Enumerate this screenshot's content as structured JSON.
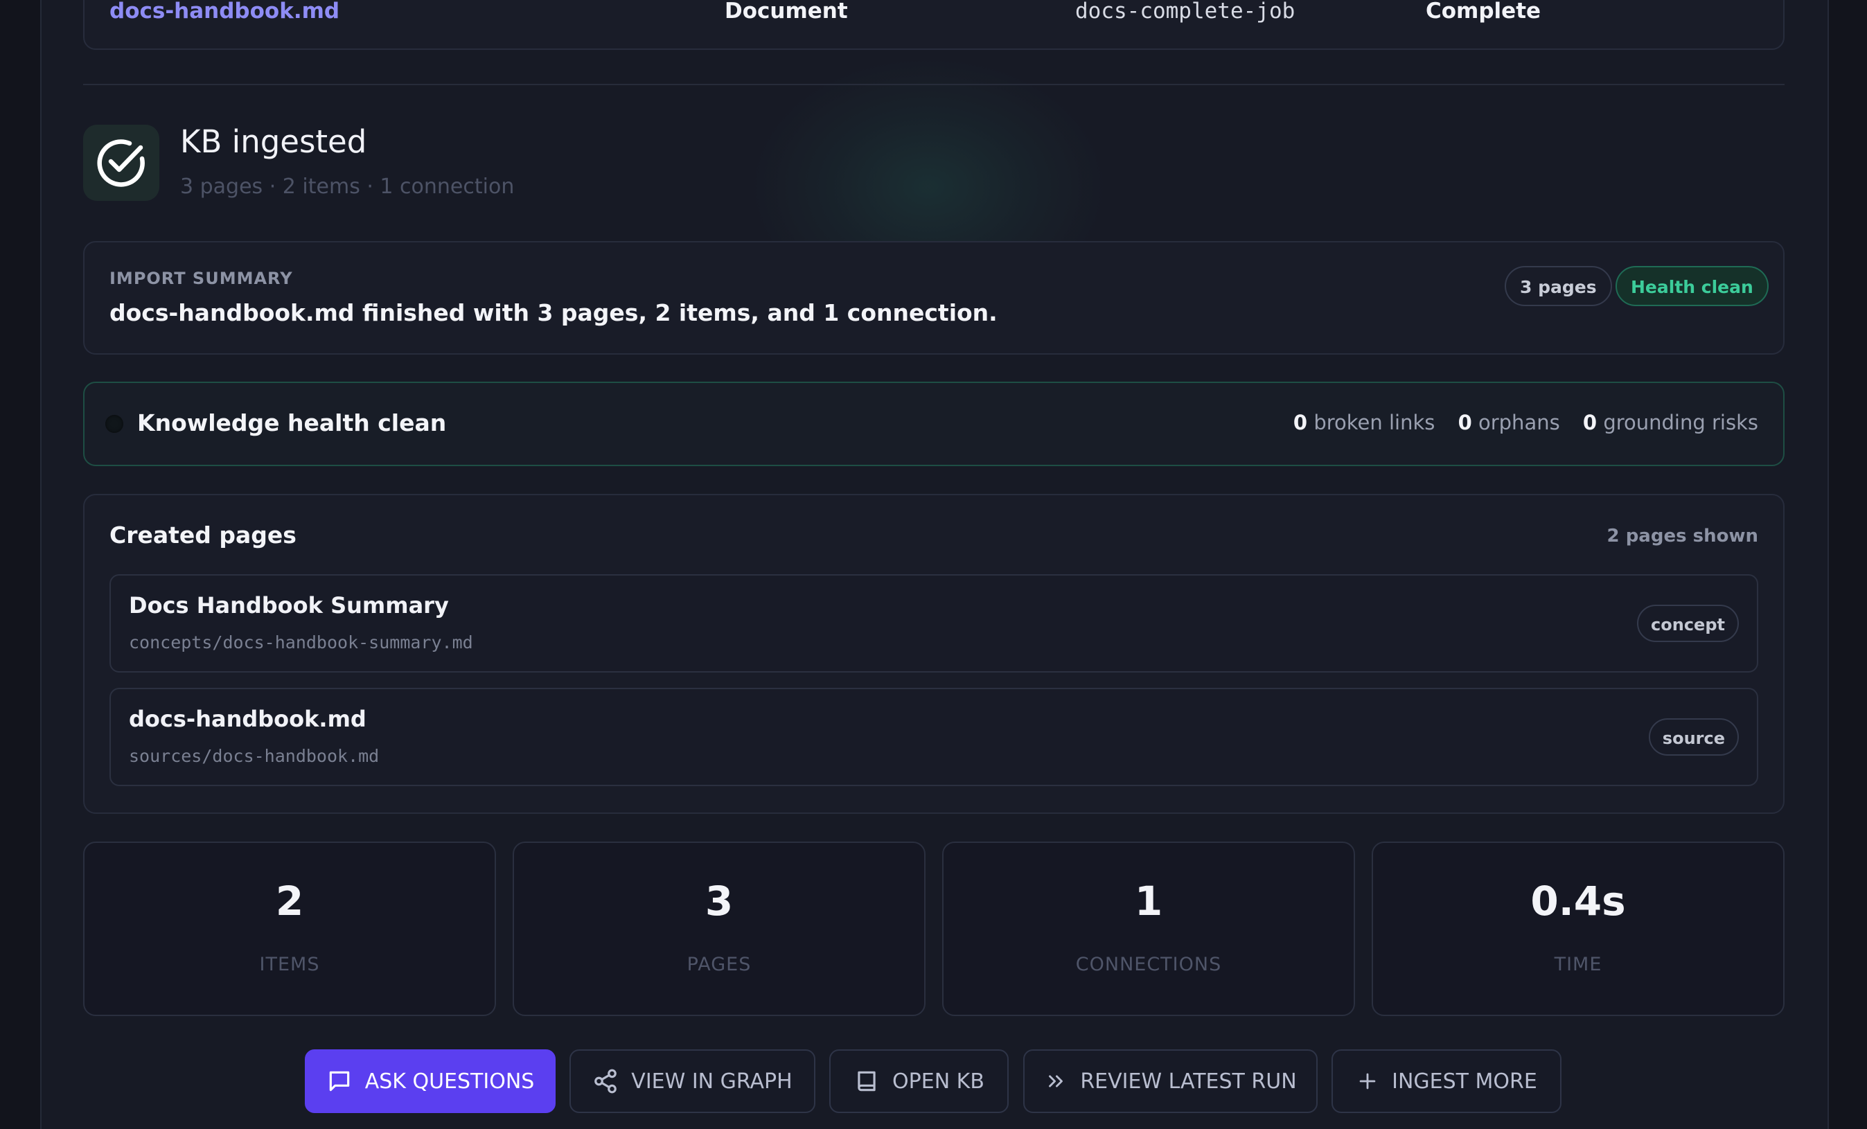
{
  "top_row": {
    "file": "docs-handbook.md",
    "type": "Document",
    "job": "docs-complete-job",
    "status": "Complete"
  },
  "hero": {
    "title": "KB ingested",
    "subtitle": "3 pages · 2 items · 1 connection"
  },
  "import_summary": {
    "label": "IMPORT SUMMARY",
    "text": "docs-handbook.md finished with 3 pages, 2 items, and 1 connection.",
    "pages_pill": "3 pages",
    "health_pill": "Health clean"
  },
  "health": {
    "title": "Knowledge health clean",
    "broken_links_count": "0",
    "broken_links_label": "broken links",
    "orphans_count": "0",
    "orphans_label": "orphans",
    "grounding_count": "0",
    "grounding_label": "grounding risks"
  },
  "created_pages": {
    "title": "Created pages",
    "count_label": "2 pages shown",
    "items": [
      {
        "name": "Docs Handbook Summary",
        "path": "concepts/docs-handbook-summary.md",
        "tag": "concept"
      },
      {
        "name": "docs-handbook.md",
        "path": "sources/docs-handbook.md",
        "tag": "source"
      }
    ]
  },
  "stats": [
    {
      "value": "2",
      "label": "ITEMS"
    },
    {
      "value": "3",
      "label": "PAGES"
    },
    {
      "value": "1",
      "label": "CONNECTIONS"
    },
    {
      "value": "0.4s",
      "label": "TIME"
    }
  ],
  "actions": {
    "ask": "ASK QUESTIONS",
    "graph": "VIEW IN GRAPH",
    "open_kb": "OPEN KB",
    "review": "REVIEW LATEST RUN",
    "ingest": "INGEST MORE"
  },
  "colors": {
    "accent": "#5b3ff0",
    "link": "#8e8cf5",
    "health": "#3ccc9a"
  }
}
